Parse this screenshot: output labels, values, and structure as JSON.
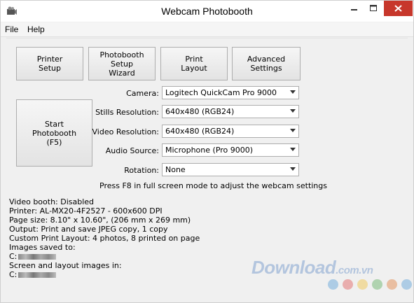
{
  "window": {
    "title": "Webcam Photobooth"
  },
  "menu": [
    "File",
    "Help"
  ],
  "buttons": {
    "printer_setup": "Printer\nSetup",
    "setup_wizard": "Photobooth\nSetup\nWizard",
    "print_layout": "Print\nLayout",
    "advanced_settings": "Advanced\nSettings",
    "start_photobooth": "Start\nPhotobooth\n(F5)"
  },
  "fields": [
    {
      "label": "Camera:",
      "value": "Logitech QuickCam Pro 9000"
    },
    {
      "label": "Stills Resolution:",
      "value": "640x480 (RGB24)"
    },
    {
      "label": "Video Resolution:",
      "value": "640x480 (RGB24)"
    },
    {
      "label": "Audio Source:",
      "value": "Microphone (Pro 9000)"
    },
    {
      "label": "Rotation:",
      "value": "None"
    }
  ],
  "note": "Press F8 in full screen mode to adjust the webcam settings",
  "info": [
    "Video booth: Disabled",
    "Printer: AL-MX20-4F2527 - 600x600 DPI",
    "Page size: 8.10\" x 10.60\", (206 mm x 269 mm)",
    "Output: Print and save JPEG copy, 1 copy",
    "Custom Print Layout: 4 photos, 8 printed on page",
    "Images saved to:",
    "C:",
    "Screen and layout images in:",
    "C:"
  ],
  "watermark": {
    "main": "Download",
    "suffix": ".com.vn"
  },
  "colors": {
    "close_button": "#c7372b",
    "watermark": "#9fb7d8"
  }
}
